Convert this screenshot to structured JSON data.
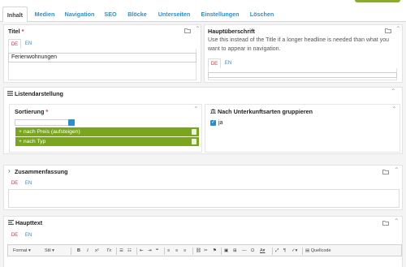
{
  "tabs": [
    {
      "label": "Inhalt",
      "active": true
    },
    {
      "label": "Medien"
    },
    {
      "label": "Navigation"
    },
    {
      "label": "SEO"
    },
    {
      "label": "Blöcke"
    },
    {
      "label": "Unterseiten"
    },
    {
      "label": "Einstellungen"
    },
    {
      "label": "Löschen"
    }
  ],
  "titel": {
    "label": "Titel",
    "required": "*",
    "langs": [
      "DE",
      "EN"
    ],
    "value": "Ferienwohnungen"
  },
  "hauptueberschrift": {
    "label": "Hauptüberschrift",
    "description": "Use this instead of the Title if a longer headline is needed than what you want to appear in navigation.",
    "langs": [
      "DE",
      "EN"
    ]
  },
  "listendarstellung": {
    "label": "Listendarstellung",
    "sortierung": {
      "label": "Sortierung",
      "required": "*",
      "items": [
        "nach Preis (aufsteigen)",
        "nach Typ"
      ]
    },
    "gruppieren": {
      "label": "Nach Unterkunftsarten gruppieren",
      "checkbox_label": "ja",
      "checked": true
    }
  },
  "zusammenfassung": {
    "label": "Zusammenfassung",
    "langs": [
      "DE",
      "EN"
    ]
  },
  "haupttext": {
    "label": "Haupttext",
    "langs": [
      "DE",
      "EN"
    ],
    "toolbar": {
      "format": "Format",
      "stil": "Stil",
      "bold": "B",
      "italic": "I",
      "superscript": "x²",
      "remove_format": "Tx",
      "omega": "Ω",
      "font_color": "A",
      "source": "Quellcode"
    }
  },
  "colors": {
    "accent": "#2a8fd0",
    "required": "#d8334a",
    "sort_item": "#7aa520"
  }
}
